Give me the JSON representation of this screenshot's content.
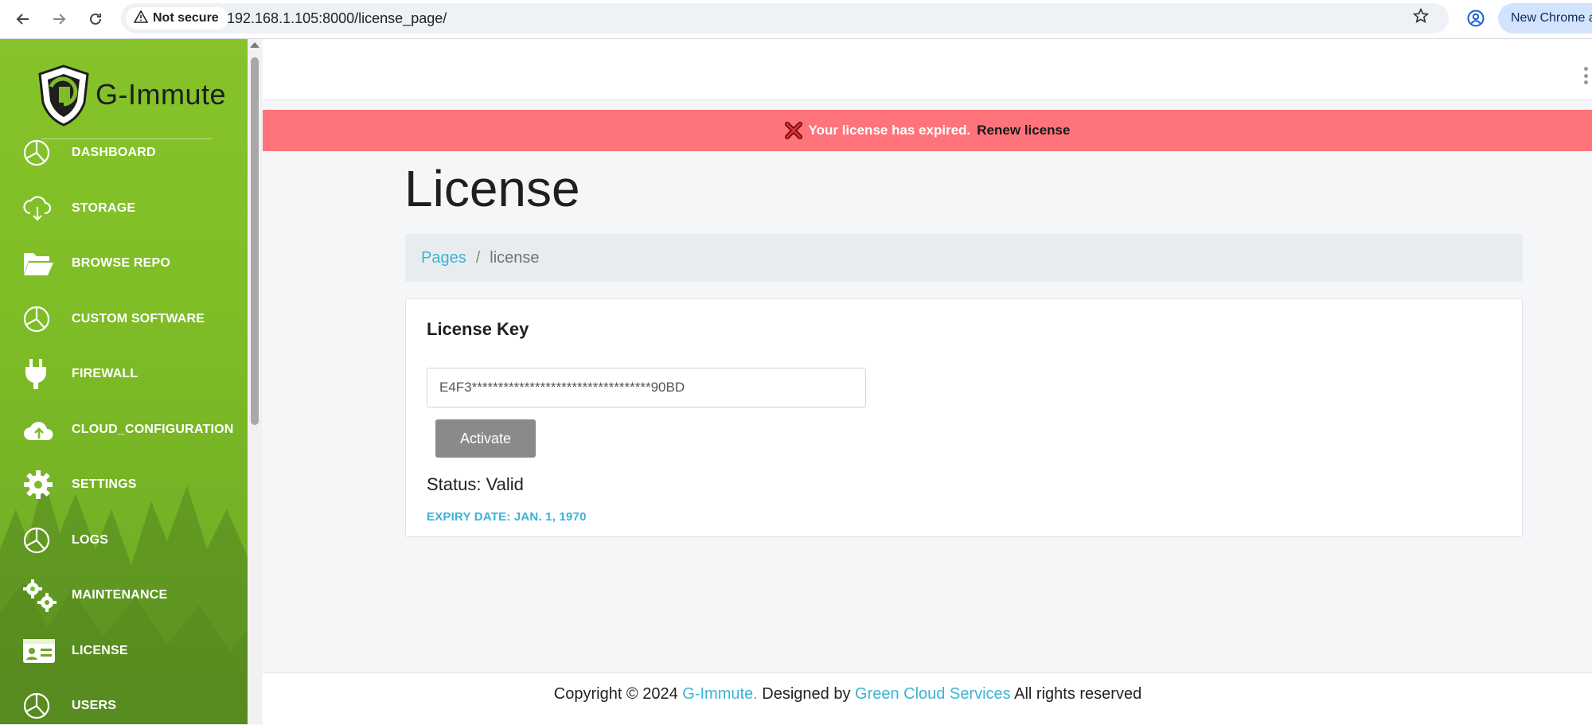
{
  "browser": {
    "security_label": "Not secure",
    "url": "192.168.1.105:8000/license_page/",
    "new_chrome_label": "New Chrome av",
    "icons": [
      "back-icon",
      "forward-icon",
      "reload-icon",
      "warning-icon",
      "star-icon",
      "profile-icon"
    ]
  },
  "sidebar": {
    "brand": "G-Immute",
    "items": [
      {
        "label": "DASHBOARD",
        "icon": "pie-chart-icon"
      },
      {
        "label": "STORAGE",
        "icon": "cloud-download-icon"
      },
      {
        "label": "BROWSE REPO",
        "icon": "folder-open-icon"
      },
      {
        "label": "CUSTOM SOFTWARE",
        "icon": "pie-chart-icon"
      },
      {
        "label": "FIREWALL",
        "icon": "plug-icon"
      },
      {
        "label": "CLOUD_CONFIGURATION",
        "icon": "cloud-upload-icon"
      },
      {
        "label": "SETTINGS",
        "icon": "gear-icon"
      },
      {
        "label": "LOGS",
        "icon": "pie-chart-icon"
      },
      {
        "label": "MAINTENANCE",
        "icon": "gears-icon"
      },
      {
        "label": "LICENSE",
        "icon": "id-card-icon"
      },
      {
        "label": "USERS",
        "icon": "pie-chart-icon"
      }
    ]
  },
  "alert": {
    "message": "Your license has expired.",
    "link": "Renew license"
  },
  "page": {
    "title": "License"
  },
  "breadcrumb": {
    "link": "Pages",
    "separator": "/",
    "current": "license"
  },
  "license_card": {
    "title": "License Key",
    "key_value": "E4F3**********************************90BD",
    "activate_label": "Activate",
    "status": "Status: Valid",
    "expiry": "EXPIRY DATE: JAN. 1, 1970"
  },
  "footer": {
    "prefix": "Copyright © 2024 ",
    "brand_link": "G-Immute.",
    "designed_by": " Designed by ",
    "company_link": "Green Cloud Services",
    "suffix": " All rights reserved"
  },
  "colors": {
    "sidebar_green": "#7fbd27",
    "alert_red": "#ff737a",
    "link_blue": "#3bb3d6"
  }
}
